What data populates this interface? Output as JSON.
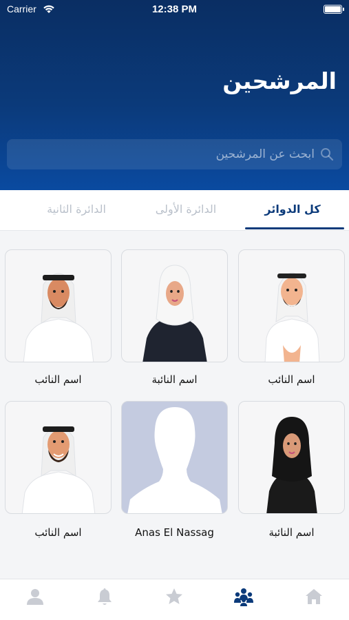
{
  "status_bar": {
    "carrier": "Carrier",
    "time": "12:38 PM"
  },
  "header": {
    "title": "المرشحين"
  },
  "search": {
    "placeholder": "ابحث عن المرشحين",
    "value": ""
  },
  "tabs": [
    {
      "label": "كل الدوائر",
      "active": true
    },
    {
      "label": "الدائرة الأولى",
      "active": false
    },
    {
      "label": "الدائرة الثانية",
      "active": false
    }
  ],
  "candidates": [
    {
      "name": "اسم النائب",
      "avatar": "man-ghutra-white-icon"
    },
    {
      "name": "اسم النائبة",
      "avatar": "woman-white-hijab-icon"
    },
    {
      "name": "اسم النائب",
      "avatar": "man-ghutra-red-icon"
    },
    {
      "name": "اسم النائبة",
      "avatar": "woman-black-hijab-icon"
    },
    {
      "name": "Anas El Nassag",
      "avatar": "default-person-silhouette-icon"
    },
    {
      "name": "اسم النائب",
      "avatar": "man-ghutra-red-smiling-icon"
    }
  ],
  "tabbar": [
    {
      "icon": "home-icon",
      "active": false
    },
    {
      "icon": "candidates-group-icon",
      "active": true
    },
    {
      "icon": "star-icon",
      "active": false
    },
    {
      "icon": "bell-icon",
      "active": false
    },
    {
      "icon": "profile-icon",
      "active": false
    }
  ],
  "colors": {
    "primary": "#0b3a7a",
    "inactive_tab": "#b9c0ca",
    "placeholder_card": "#c4cbe0",
    "tabbar_icon": "#c9ccd3"
  }
}
